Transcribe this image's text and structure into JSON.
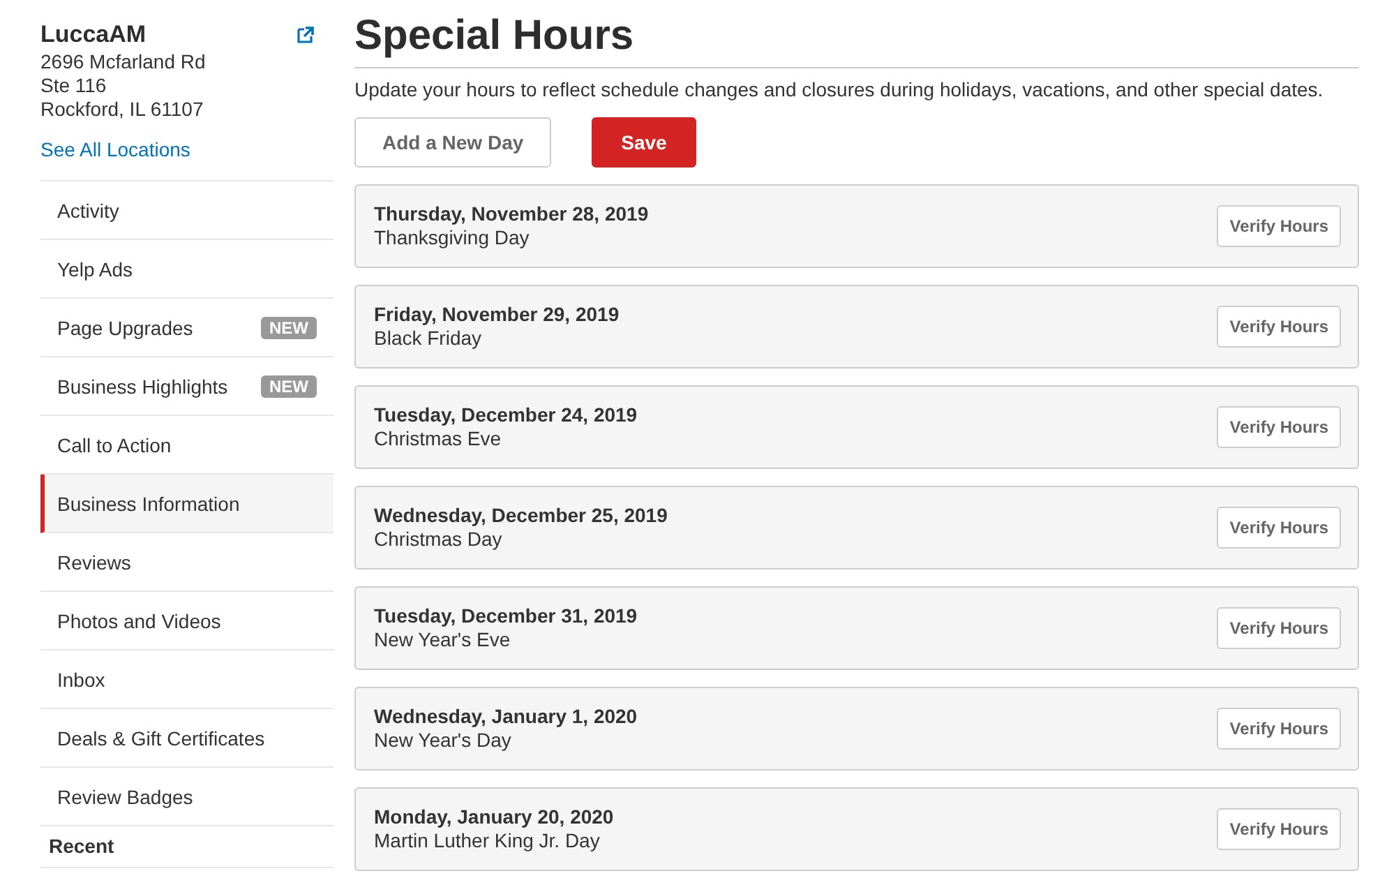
{
  "business": {
    "name": "LuccaAM",
    "address": [
      "2696 Mcfarland Rd",
      "Ste 116",
      "Rockford, IL 61107"
    ],
    "locations_link": "See All Locations"
  },
  "sidebar": {
    "items": [
      {
        "label": "Activity",
        "selected": false
      },
      {
        "label": "Yelp Ads",
        "selected": false
      },
      {
        "label": "Page Upgrades",
        "selected": false,
        "badge": "NEW"
      },
      {
        "label": "Business Highlights",
        "selected": false,
        "badge": "NEW"
      },
      {
        "label": "Call to Action",
        "selected": false
      },
      {
        "label": "Business Information",
        "selected": true
      },
      {
        "label": "Reviews",
        "selected": false
      },
      {
        "label": "Photos and Videos",
        "selected": false
      },
      {
        "label": "Inbox",
        "selected": false
      },
      {
        "label": "Deals & Gift Certificates",
        "selected": false
      },
      {
        "label": "Review Badges",
        "selected": false
      }
    ],
    "section_heading": "Recent"
  },
  "page": {
    "title": "Special Hours",
    "description": "Update your hours to reflect schedule changes and closures during holidays, vacations, and other special dates.",
    "buttons": [
      "Add a New Day",
      "Save"
    ]
  },
  "days": [
    {
      "date": "Thursday, November 28, 2019",
      "name": "Thanksgiving Day",
      "action": "Verify Hours"
    },
    {
      "date": "Friday, November 29, 2019",
      "name": "Black Friday",
      "action": "Verify Hours"
    },
    {
      "date": "Tuesday, December 24, 2019",
      "name": "Christmas Eve",
      "action": "Verify Hours"
    },
    {
      "date": "Wednesday, December 25, 2019",
      "name": "Christmas Day",
      "action": "Verify Hours"
    },
    {
      "date": "Tuesday, December 31, 2019",
      "name": "New Year's Eve",
      "action": "Verify Hours"
    },
    {
      "date": "Wednesday, January 1, 2020",
      "name": "New Year's Day",
      "action": "Verify Hours"
    },
    {
      "date": "Monday, January 20, 2020",
      "name": "Martin Luther King Jr. Day",
      "action": "Verify Hours"
    }
  ]
}
